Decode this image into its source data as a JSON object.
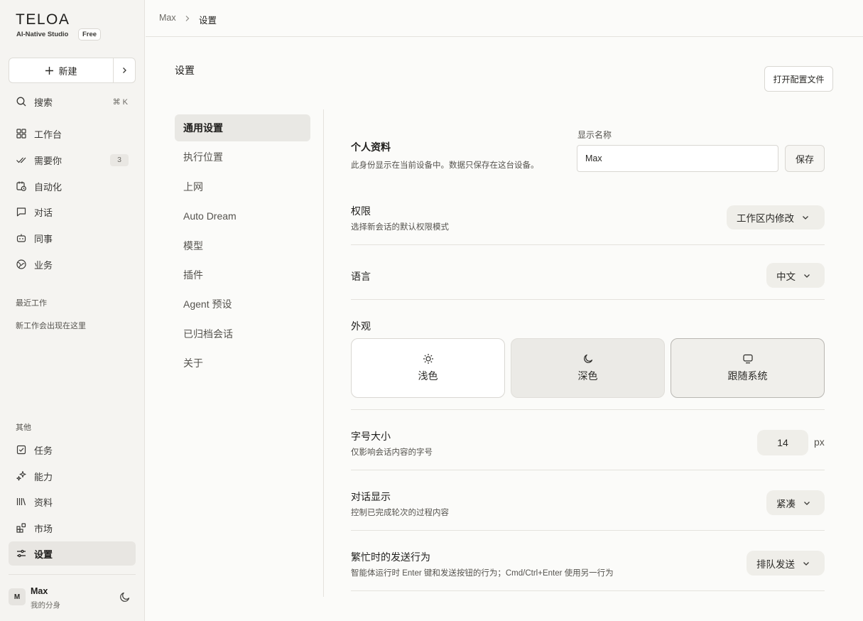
{
  "sidebar": {
    "brand": "TELOA",
    "brand_sub": "AI-Native Studio",
    "plan_badge": "Free",
    "new_label": "新建",
    "search": {
      "label": "搜索",
      "shortcut": "⌘ K"
    },
    "nav": [
      {
        "label": "工作台"
      },
      {
        "label": "需要你",
        "count": "3"
      },
      {
        "label": "自动化"
      },
      {
        "label": "对话"
      },
      {
        "label": "同事"
      },
      {
        "label": "业务"
      }
    ],
    "recent_label": "最近工作",
    "recent_empty": "新工作会出现在这里",
    "other_label": "其他",
    "other_nav": [
      {
        "label": "任务"
      },
      {
        "label": "能力"
      },
      {
        "label": "资料"
      },
      {
        "label": "市场"
      },
      {
        "label": "设置"
      }
    ],
    "user": {
      "initial": "M",
      "name": "Max",
      "subtitle": "我的分身"
    }
  },
  "breadcrumb": {
    "parent": "Max",
    "current": "设置"
  },
  "page": {
    "title": "设置",
    "open_config_label": "打开配置文件"
  },
  "settings_nav": [
    "通用设置",
    "执行位置",
    "上网",
    "Auto Dream",
    "模型",
    "插件",
    "Agent 预设",
    "已归档会话",
    "关于"
  ],
  "general": {
    "profile": {
      "title": "个人资料",
      "desc": "此身份显示在当前设备中。数据只保存在这台设备。",
      "field_label": "显示名称",
      "field_value": "Max",
      "save_label": "保存"
    },
    "permissions": {
      "title": "权限",
      "desc": "选择新会话的默认权限模式",
      "value": "工作区内修改"
    },
    "language": {
      "title": "语言",
      "value": "中文"
    },
    "appearance": {
      "title": "外观",
      "options": [
        {
          "label": "浅色",
          "icon": "sun-icon"
        },
        {
          "label": "深色",
          "icon": "moon-icon"
        },
        {
          "label": "跟随系统",
          "icon": "monitor-icon"
        }
      ],
      "selected": "跟随系统"
    },
    "font_size": {
      "title": "字号大小",
      "desc": "仅影响会话内容的字号",
      "value": "14",
      "unit": "px"
    },
    "chat_display": {
      "title": "对话显示",
      "desc": "控制已完成轮次的过程内容",
      "value": "紧凑"
    },
    "busy_send": {
      "title": "繁忙时的发送行为",
      "desc": "智能体运行时 Enter 键和发送按钮的行为；Cmd/Ctrl+Enter 使用另一行为",
      "value": "排队发送"
    }
  }
}
